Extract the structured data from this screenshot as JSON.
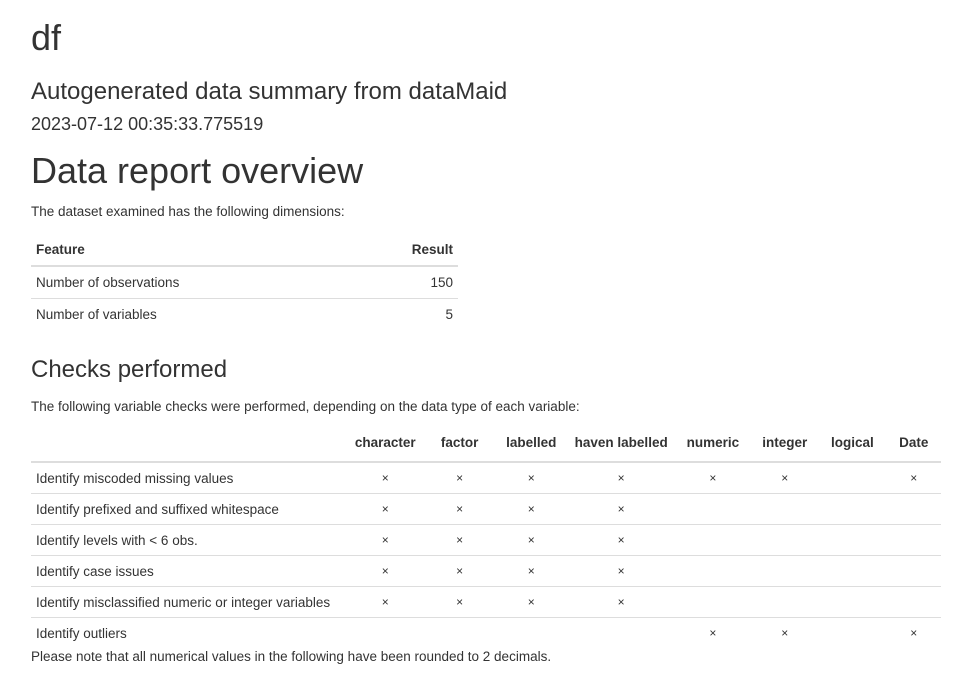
{
  "header": {
    "title": "df",
    "subtitle": "Autogenerated data summary from dataMaid",
    "date": "2023-07-12 00:35:33.775519"
  },
  "overview": {
    "heading": "Data report overview",
    "intro": "The dataset examined has the following dimensions:",
    "columns": [
      "Feature",
      "Result"
    ],
    "rows": [
      {
        "feature": "Number of observations",
        "result": "150"
      },
      {
        "feature": "Number of variables",
        "result": "5"
      }
    ]
  },
  "checks": {
    "heading": "Checks performed",
    "intro": "The following variable checks were performed, depending on the data type of each variable:",
    "columns": [
      "",
      "character",
      "factor",
      "labelled",
      "haven labelled",
      "numeric",
      "integer",
      "logical",
      "Date"
    ],
    "mark": "×",
    "rows": [
      {
        "label": "Identify miscoded missing values",
        "cells": [
          "×",
          "×",
          "×",
          "×",
          "×",
          "×",
          "",
          "×"
        ]
      },
      {
        "label": "Identify prefixed and suffixed whitespace",
        "cells": [
          "×",
          "×",
          "×",
          "×",
          "",
          "",
          "",
          ""
        ]
      },
      {
        "label": "Identify levels with < 6 obs.",
        "cells": [
          "×",
          "×",
          "×",
          "×",
          "",
          "",
          "",
          ""
        ]
      },
      {
        "label": "Identify case issues",
        "cells": [
          "×",
          "×",
          "×",
          "×",
          "",
          "",
          "",
          ""
        ]
      },
      {
        "label": "Identify misclassified numeric or integer variables",
        "cells": [
          "×",
          "×",
          "×",
          "×",
          "",
          "",
          "",
          ""
        ]
      },
      {
        "label": "Identify outliers",
        "cells": [
          "",
          "",
          "",
          "",
          "×",
          "×",
          "",
          "×"
        ]
      }
    ]
  },
  "footer_note": "Please note that all numerical values in the following have been rounded to 2 decimals."
}
